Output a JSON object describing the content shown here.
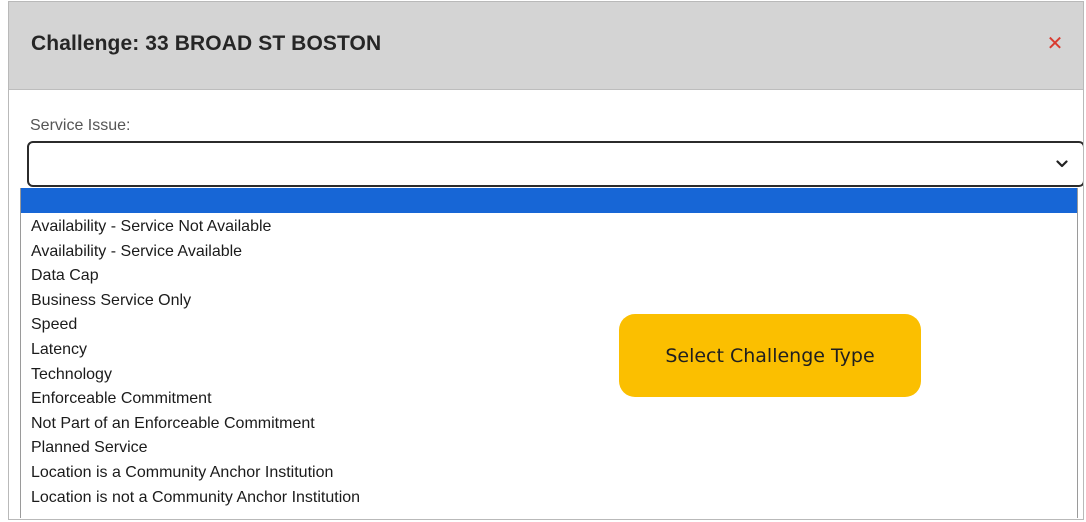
{
  "dialog": {
    "title": "Challenge: 33 BROAD ST BOSTON",
    "close_icon": "close-icon",
    "close_glyph": "✕",
    "close_color": "#d93b30"
  },
  "form": {
    "service_issue_label": "Service Issue:",
    "service_issue_value": "",
    "chevron_icon": "chevron-down-icon"
  },
  "dropdown": {
    "highlight_color": "#1766d6",
    "options": [
      "Availability - Service Not Available",
      "Availability - Service Available",
      "Data Cap",
      "Business Service Only",
      "Speed",
      "Latency",
      "Technology",
      "Enforceable Commitment",
      "Not Part of an Enforceable Commitment",
      "Planned Service",
      "Location is a Community Anchor Institution",
      "Location is not a Community Anchor Institution"
    ]
  },
  "callout": {
    "text": "Select Challenge Type",
    "color": "#fbbf00"
  }
}
